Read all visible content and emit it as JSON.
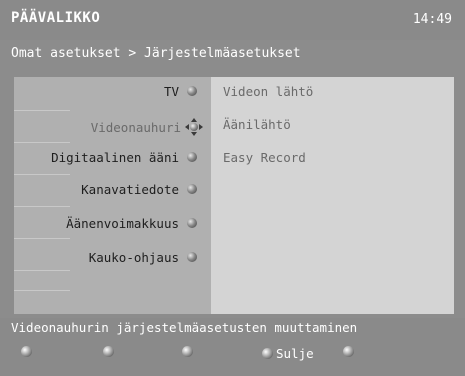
{
  "header": {
    "title": "PÄÄVALIKKO",
    "clock": "14:49"
  },
  "breadcrumb": "Omat asetukset > Järjestelmäasetukset",
  "menu": {
    "items": [
      {
        "label": "TV",
        "selected": false
      },
      {
        "label": "Videonauhuri",
        "selected": true
      },
      {
        "label": "Digitaalinen ääni",
        "selected": false
      },
      {
        "label": "Kanavatiedote",
        "selected": false
      },
      {
        "label": "Äänenvoimakkuus",
        "selected": false
      },
      {
        "label": "Kauko-ohjaus",
        "selected": false
      }
    ]
  },
  "submenu": {
    "items": [
      {
        "label": "Videon lähtö"
      },
      {
        "label": "Äänilähtö"
      },
      {
        "label": "Easy Record"
      }
    ]
  },
  "status_text": "Videonauhurin järjestelmäasetusten muuttaminen",
  "footer": {
    "buttons": [
      {
        "label": ""
      },
      {
        "label": ""
      },
      {
        "label": ""
      },
      {
        "label": "Sulje"
      },
      {
        "label": ""
      }
    ]
  },
  "colors": {
    "frame": "#8c8c8c",
    "left_panel": "#b0b0b0",
    "right_panel": "#d4d4d4"
  }
}
